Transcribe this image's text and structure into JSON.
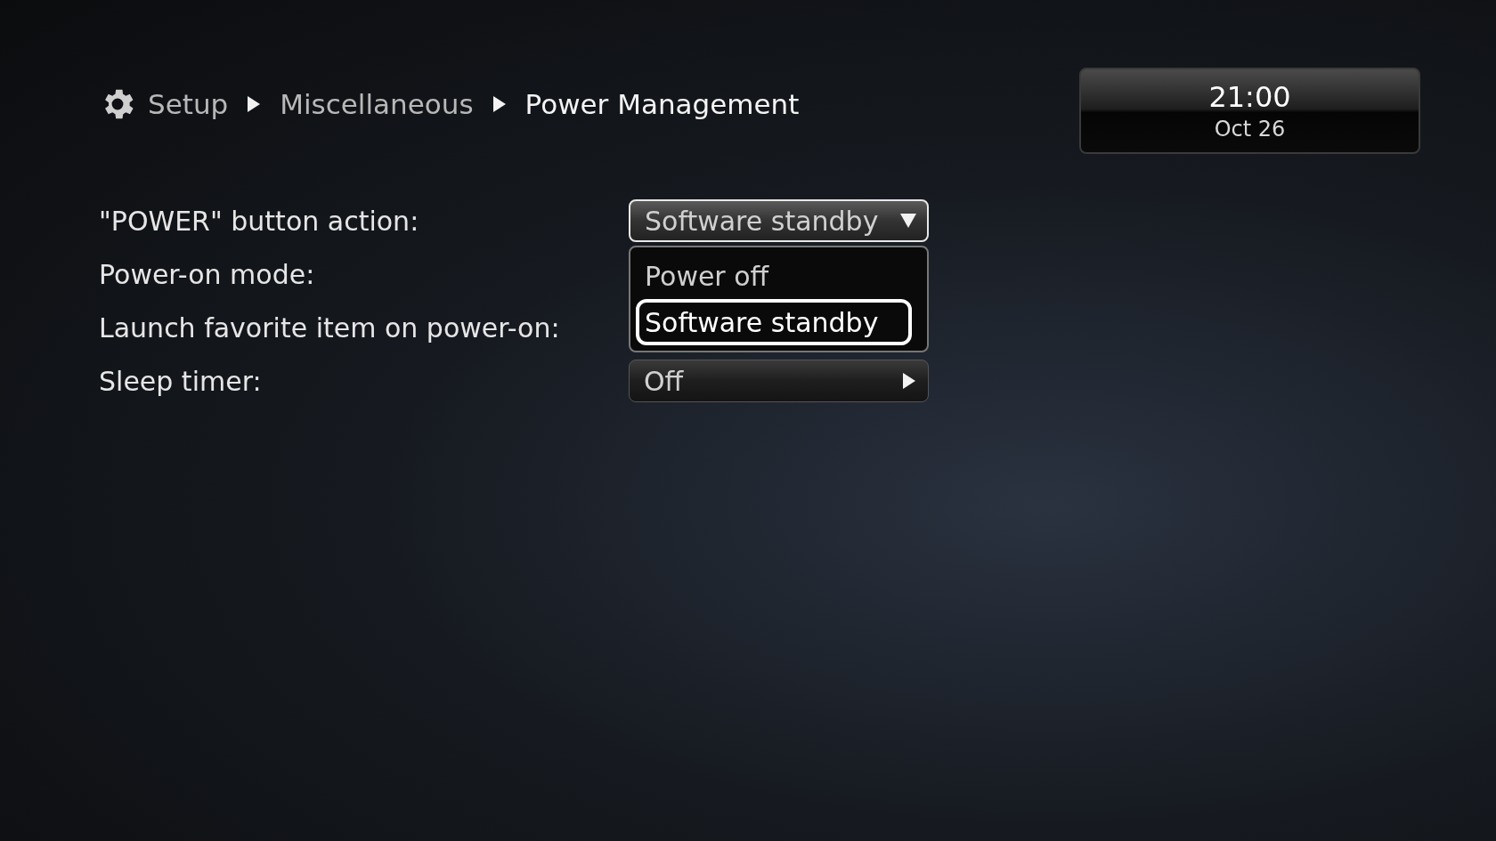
{
  "breadcrumb": [
    {
      "label": "Setup",
      "current": false
    },
    {
      "label": "Miscellaneous",
      "current": false
    },
    {
      "label": "Power Management",
      "current": true
    }
  ],
  "clock": {
    "time": "21:00",
    "date": "Oct 26"
  },
  "settings": [
    {
      "label": "\"POWER\" button action:",
      "kind": "dropdown",
      "value": "Software standby",
      "expanded": true,
      "options": [
        {
          "label": "Power off",
          "selected": false
        },
        {
          "label": "Software standby",
          "selected": true
        }
      ]
    },
    {
      "label": "Power-on mode:",
      "kind": "hidden"
    },
    {
      "label": "Launch favorite item on power-on:",
      "kind": "hidden"
    },
    {
      "label": "Sleep timer:",
      "kind": "submenu",
      "value": "Off"
    }
  ]
}
